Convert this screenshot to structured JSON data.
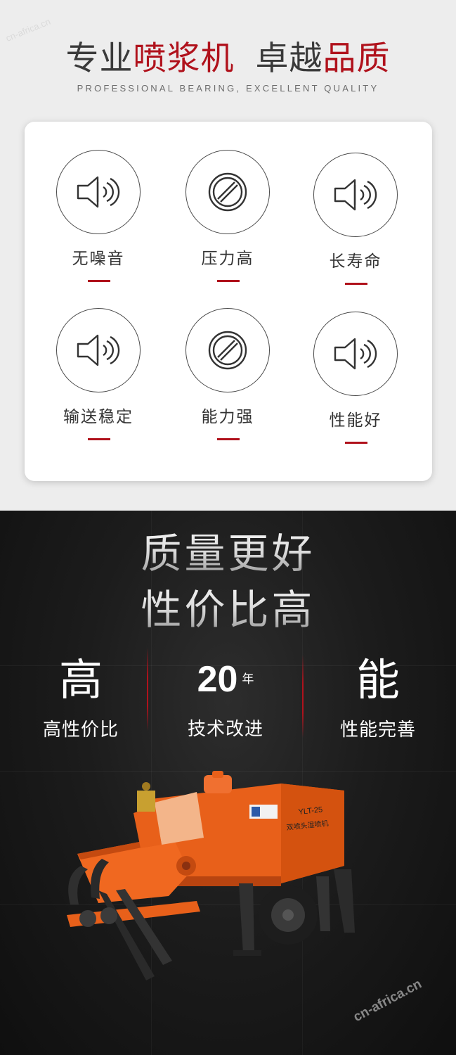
{
  "header": {
    "title_part1": "专业",
    "title_part2": "喷浆机",
    "title_part3": "卓越",
    "title_part4": "品质",
    "subtitle": "PROFESSIONAL BEARING, EXCELLENT QUALITY",
    "watermark": "cn-africa.cn"
  },
  "features": [
    {
      "label": "无噪音",
      "icon": "speaker-icon"
    },
    {
      "label": "压力高",
      "icon": "prohibited-icon"
    },
    {
      "label": "长寿命",
      "icon": "speaker-icon"
    },
    {
      "label": "输送稳定",
      "icon": "speaker-icon"
    },
    {
      "label": "能力强",
      "icon": "prohibited-icon"
    },
    {
      "label": "性能好",
      "icon": "speaker-icon"
    }
  ],
  "promo": {
    "line1": "质量更好",
    "line2": "性价比高"
  },
  "stats": [
    {
      "value": "高",
      "unit": "",
      "desc": "高性价比"
    },
    {
      "value": "20",
      "unit": "年",
      "desc": "技术改进"
    },
    {
      "value": "能",
      "unit": "",
      "desc": "性能完善"
    }
  ],
  "machine": {
    "model": "YLT-25",
    "name": "双喷头湿喷机"
  },
  "footer_watermark": "cn-africa.cn",
  "colors": {
    "accent_red": "#b0121c",
    "machine_orange": "#e8601a",
    "dark_bg": "#1c1c1c"
  }
}
